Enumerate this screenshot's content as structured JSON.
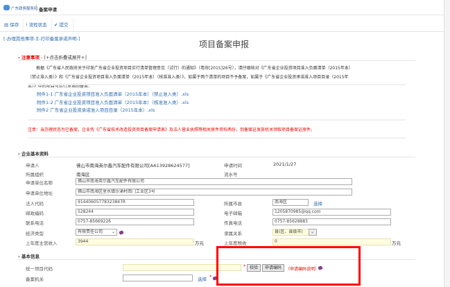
{
  "header": {
    "logo_text": "广东政务服务网",
    "title": "备案申请"
  },
  "toolbar": {
    "save": "保存",
    "status": "流程状态",
    "submit": "提交"
  },
  "top_links": "[-办理其他事项-][-打印备案承诺声明-]",
  "page_title": "项目备案申报",
  "notice": {
    "label": "注意事项",
    "toggle": " - [+点击折叠或展开+]",
    "paragraph": "根据《广东省人民政府关于印发广东省企业投资项目实行清单管理意见（试行）的通知》（粤府[2015]26号），请仔细核对《广东省企业投资项目准入负面清单（2015年本）（禁止准入类）》和《广东省企业投资项目准入负面清单（2015年本）（核准准入类）》，如属于两个清单的项目不予备案，如属于《广东省企业投资承诺准入项目目录（2015年本）》中的项目可实行承诺制备案：",
    "attachments": [
      "附件1-1 广东省企业投资项目准入负面清单（2015年本）（禁止准入类）.xls",
      "附件1-2 广东省企业投资项目准入负面清单（2015年本）（核准准入类）.xls",
      "附件2 广东省企业投资承诺准入项目目录（2015年本）.xls"
    ],
    "warning": "注意：当办理状态为已备案，企业凭《广东省技术改造投资项目备案申请表》及法人营业执照等相关原件资料两份，到备案证发放机关领取项目备案证原件。"
  },
  "company": {
    "section": "企业基本资料",
    "applicant_label": "申请人",
    "applicant": "佛山市南海英尔鑫汽车配件有限公司[AA13928624577]",
    "apply_time_label": "申请时间",
    "apply_time": "2021/1/27",
    "org_label": "所属组织",
    "org": "南海区",
    "serial_label": "流水号",
    "name_label": "申请单位名称",
    "name": "佛山市南海英尔鑫汽车配件有限公司",
    "address_label": "申请单位地址",
    "address": "佛山市南海区里水镇沙涌村南门工业区3号",
    "legal_code_label": "法人代码",
    "legal_code": "91440605778323847R",
    "county_label": "所属市县",
    "county": "南海区",
    "select": "选择",
    "postcode_label": "邮政编码",
    "postcode": "528244",
    "email_label": "电子邮箱",
    "email": "1205870985@qq.com",
    "phone_label": "联系电话",
    "phone": "0757-85669226",
    "fax_label": "传真电话",
    "fax": "0757-85628883",
    "econ_label": "经济类型",
    "econ": "有限责任公司",
    "affil_label": "隶属关系",
    "affil": "县(区、县级市)",
    "revenue_label": "上年度主营收入",
    "revenue": "3944",
    "unit": "万元",
    "tax_label": "上年度税收",
    "tax": "0"
  },
  "basic": {
    "section": "基本信息",
    "code_label": "统一项目代码",
    "verify": "校验",
    "apply_code": "申请编码",
    "apply_note": "（申请编码说明）",
    "authority_label": "备案机关",
    "select": "选择",
    "required": "*"
  },
  "colors": {
    "highlight": "#ff0000",
    "link": "#2a6ab0"
  }
}
